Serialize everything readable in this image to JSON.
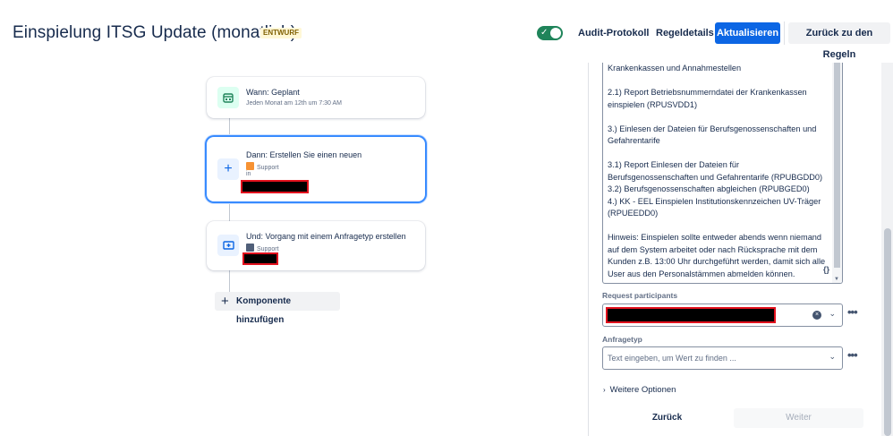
{
  "header": {
    "title": "Einspielung ITSG Update (monatlich)",
    "status_badge": "ENTWURF",
    "toggle_check": "✓",
    "audit_label": "Audit-Protokoll",
    "details_label": "Regeldetails",
    "update_label": "Aktualisieren",
    "back_label": "Zurück zu den Regeln"
  },
  "flow": {
    "trigger": {
      "title": "Wann: Geplant",
      "subtitle": "Jeden Monat am 12th um 7:30 AM",
      "icon": "calendar-icon"
    },
    "action": {
      "title": "Dann: Erstellen Sie einen neuen",
      "project": "Support",
      "in_label": "in",
      "icon": "plus-icon"
    },
    "branch": {
      "title": "Und: Vorgang mit einem Anfragetyp erstellen",
      "project": "Support",
      "icon": "request-type-icon"
    },
    "add_label": "Komponente hinzufügen",
    "add_icon": "+"
  },
  "panel": {
    "description": "Krankenkassen und Annahmestellen\n\n2.1) Report Betriebsnummerndatei der Krankenkassen einspielen (RPUSVDD1)\n\n3.) Einlesen der Dateien für Berufsgenossenschaften und Gefahrentarife\n\n3.1) Report Einlesen der Dateien für Berufsgenossenschaften und Gefahrentarife (RPUBGDD0)\n3.2) Berufsgenossenschaften abgleichen (RPUBGED0)\n4.) KK - EEL Einspielen Institutionskennzeichen UV-Träger (RPUEEDD0)\n\nHinweis: Einspielen sollte entweder abends wenn niemand auf dem System arbeitet oder nach Rücksprache mit dem Kunden z.B. 13:00 Uhr durchgeführt werden, damit sich alle User aus den Personalstämmen abmelden können.",
    "smart_values": "{}",
    "participants_label": "Request participants",
    "request_type_label": "Anfragetyp",
    "request_type_placeholder": "Text eingeben, um Wert zu finden ...",
    "more_options": "Weitere Optionen",
    "back_button": "Zurück",
    "next_button": "Weiter",
    "dots": "•••",
    "chevron": "⌄",
    "clear": "×",
    "caret": "›"
  }
}
